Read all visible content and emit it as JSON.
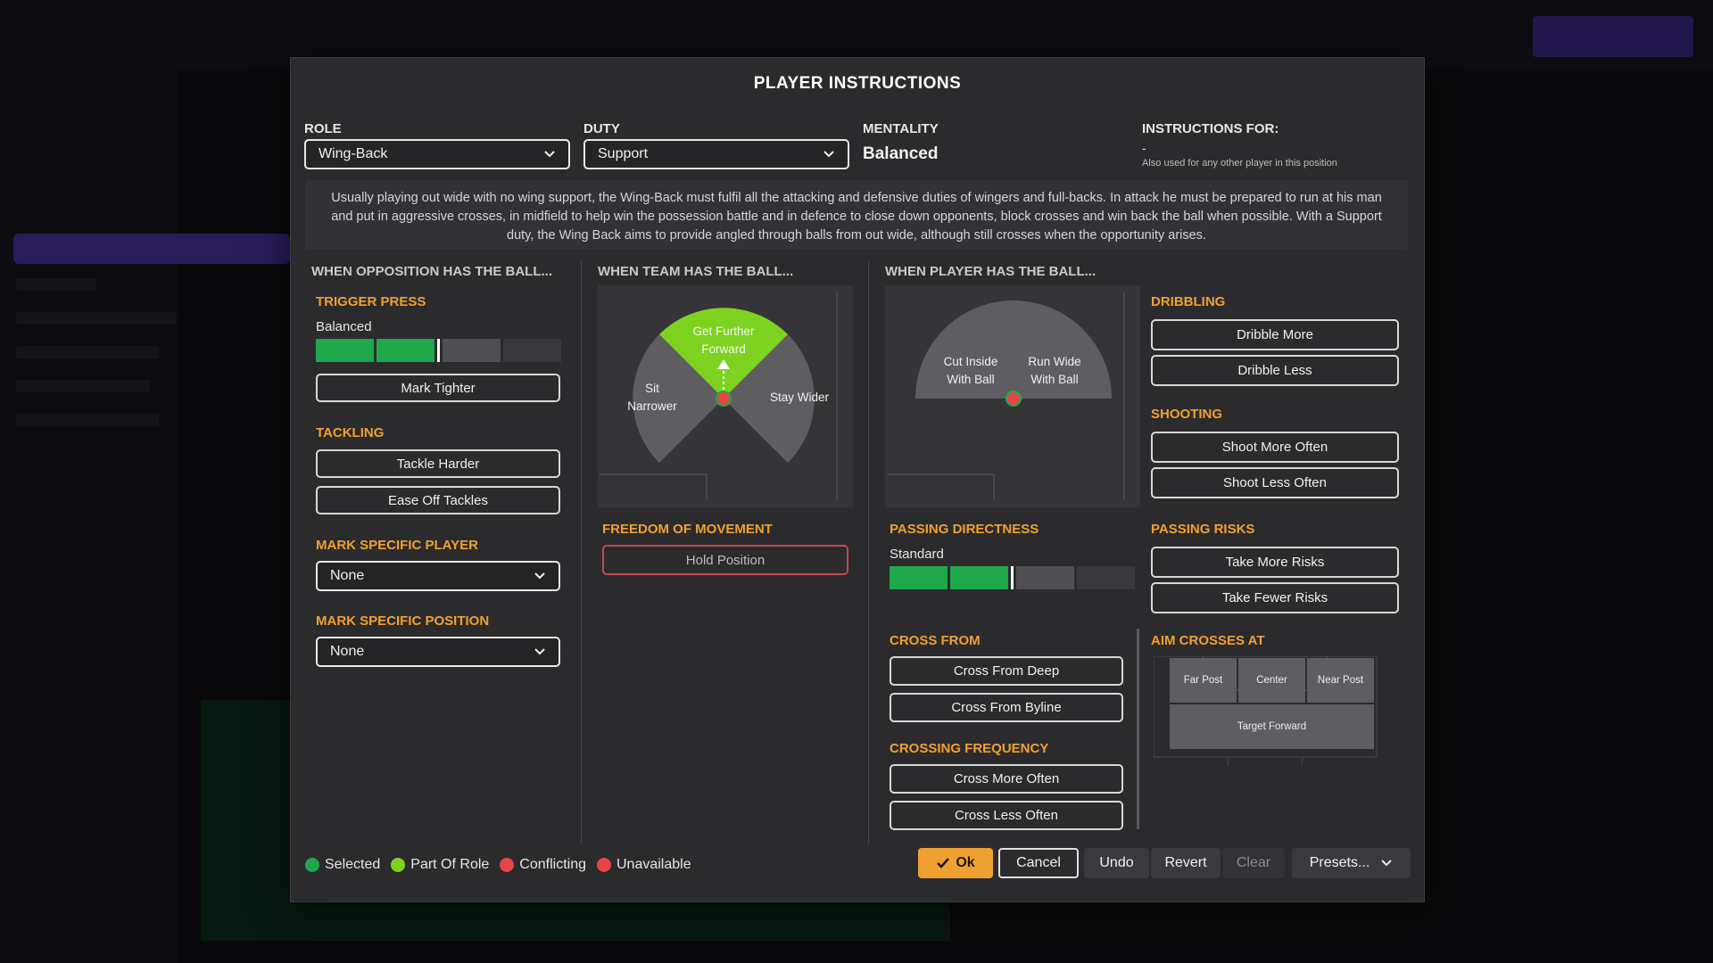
{
  "modal": {
    "title": "PLAYER INSTRUCTIONS"
  },
  "role": {
    "label": "ROLE",
    "value": "Wing-Back"
  },
  "duty": {
    "label": "DUTY",
    "value": "Support"
  },
  "mentality": {
    "label": "MENTALITY",
    "value": "Balanced"
  },
  "instructions_for": {
    "label": "INSTRUCTIONS FOR:",
    "value": "-",
    "note": "Also used for any other player in this position"
  },
  "description": "Usually playing out wide with no wing support, the Wing-Back must fulfil all the attacking and defensive duties of wingers and full-backs. In attack he must be prepared to run at his man and put in aggressive crosses, in midfield to help win the possession battle and in defence to close down opponents, block crosses and win back the ball when possible. With a Support duty, the Wing Back aims to provide angled through balls from out wide, although still crosses when the opportunity arises.",
  "opposition": {
    "header": "WHEN OPPOSITION HAS THE BALL...",
    "trigger_press": {
      "title": "TRIGGER PRESS",
      "value": "Balanced",
      "level": 0.5
    },
    "mark_tighter": "Mark Tighter",
    "tackling": {
      "title": "TACKLING",
      "harder": "Tackle Harder",
      "ease": "Ease Off Tackles"
    },
    "mark_player": {
      "title": "MARK SPECIFIC PLAYER",
      "value": "None"
    },
    "mark_position": {
      "title": "MARK SPECIFIC POSITION",
      "value": "None"
    }
  },
  "team": {
    "header": "WHEN TEAM HAS THE BALL...",
    "dial": {
      "forward": "Get Further Forward",
      "narrower": "Sit Narrower",
      "wider": "Stay Wider"
    },
    "freedom": {
      "title": "FREEDOM OF MOVEMENT",
      "hold": "Hold Position"
    }
  },
  "player": {
    "header": "WHEN PLAYER HAS THE BALL...",
    "dial": {
      "cut_inside": "Cut Inside With Ball",
      "run_wide": "Run Wide With Ball"
    },
    "passing_directness": {
      "title": "PASSING DIRECTNESS",
      "value": "Standard",
      "level": 0.5
    },
    "cross_from": {
      "title": "CROSS FROM",
      "deep": "Cross From Deep",
      "byline": "Cross From Byline"
    },
    "crossing_frequency": {
      "title": "CROSSING FREQUENCY",
      "more": "Cross More Often",
      "less": "Cross Less Often"
    },
    "dribbling": {
      "title": "DRIBBLING",
      "more": "Dribble More",
      "less": "Dribble Less"
    },
    "shooting": {
      "title": "SHOOTING",
      "more": "Shoot More Often",
      "less": "Shoot Less Often"
    },
    "passing_risks": {
      "title": "PASSING RISKS",
      "more": "Take More Risks",
      "fewer": "Take Fewer Risks"
    },
    "aim_crosses": {
      "title": "AIM CROSSES AT",
      "far": "Far Post",
      "center": "Center",
      "near": "Near Post",
      "target": "Target Forward"
    }
  },
  "legend": {
    "selected": "Selected",
    "part_of_role": "Part Of Role",
    "conflicting": "Conflicting",
    "unavailable": "Unavailable"
  },
  "footer": {
    "ok": "Ok",
    "cancel": "Cancel",
    "undo": "Undo",
    "revert": "Revert",
    "clear": "Clear",
    "presets": "Presets..."
  },
  "colors": {
    "accent": "#f0a030",
    "selected": "#1fa84a",
    "part_of_role": "#7ed321",
    "conflicting": "#e84444",
    "unavailable": "#e84444",
    "ok": "#f0a030"
  }
}
